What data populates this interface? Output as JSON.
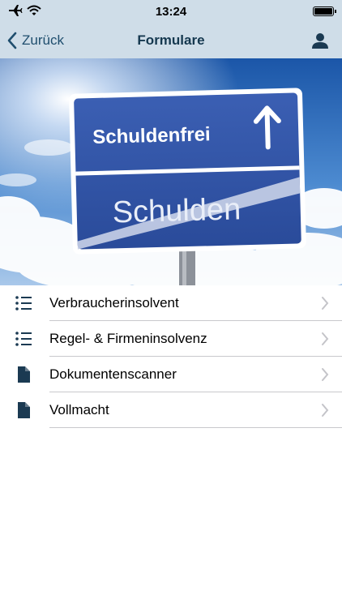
{
  "status_bar": {
    "time": "13:24",
    "icons": [
      "airplane-icon",
      "wifi-icon",
      "battery-icon"
    ]
  },
  "nav": {
    "back_label": "Zurück",
    "title": "Formulare",
    "right_icon": "user-icon"
  },
  "hero": {
    "sign_top": "Schuldenfrei",
    "sign_bottom": "Schulden"
  },
  "list": {
    "items": [
      {
        "label": "Verbraucherinsolvent",
        "icon": "list-icon"
      },
      {
        "label": "Regel- & Firmeninsolvenz",
        "icon": "list-icon"
      },
      {
        "label": "Dokumentenscanner",
        "icon": "document-icon"
      },
      {
        "label": "Vollmacht",
        "icon": "document-icon"
      }
    ]
  },
  "colors": {
    "bar_background": "#cfdde8",
    "accent": "#1f4e6e",
    "icon": "#1b3a52"
  }
}
